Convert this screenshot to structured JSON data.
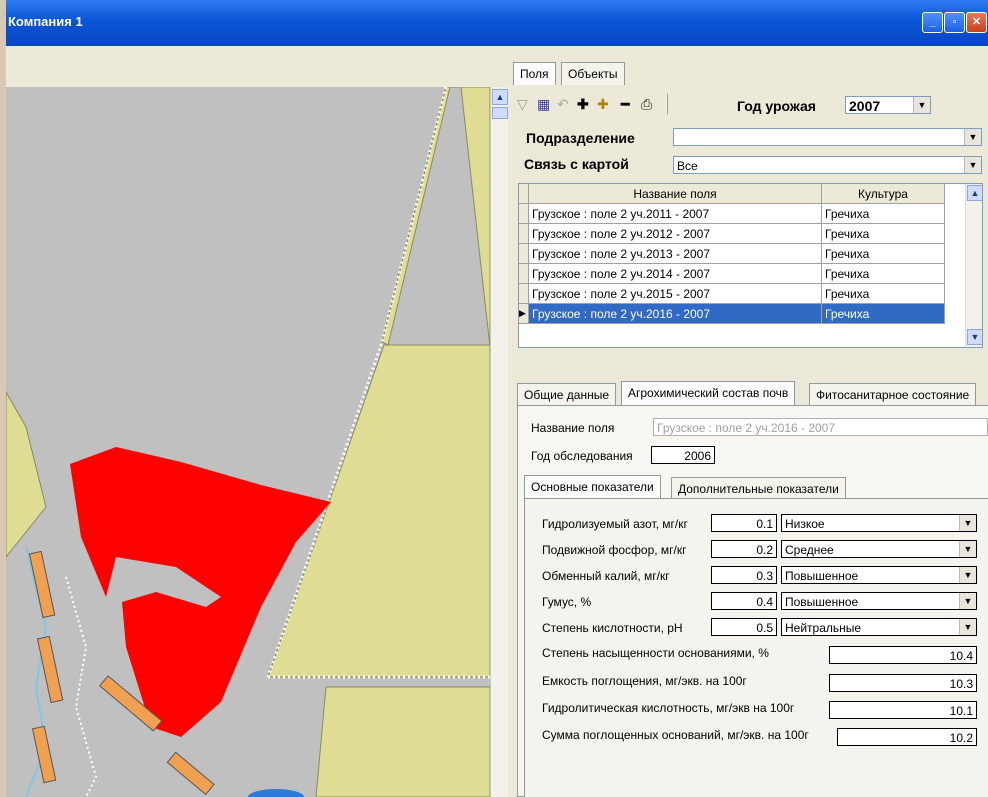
{
  "window": {
    "title": "Компания 1"
  },
  "panel": {
    "tabs": [
      "Поля",
      "Объекты"
    ],
    "year_label": "Год урожая",
    "year_value": "2007",
    "division_label": "Подразделение",
    "division_value": "",
    "map_link_label": "Связь с картой",
    "map_link_value": "Все",
    "grid": {
      "headers": [
        "Название поля",
        "Культура"
      ],
      "rows": [
        {
          "name": "Грузское : поле 2 уч.2011 - 2007",
          "crop": "Гречиха"
        },
        {
          "name": "Грузское : поле 2 уч.2012 - 2007",
          "crop": "Гречиха"
        },
        {
          "name": "Грузское : поле 2 уч.2013 - 2007",
          "crop": "Гречиха"
        },
        {
          "name": "Грузское : поле 2 уч.2014 - 2007",
          "crop": "Гречиха"
        },
        {
          "name": "Грузское : поле 2 уч.2015 - 2007",
          "crop": "Гречиха"
        },
        {
          "name": "Грузское : поле 2 уч.2016 - 2007",
          "crop": "Гречиха"
        }
      ]
    },
    "detail_tabs": [
      "Общие данные",
      "Агрохимический состав почв",
      "Фитосанитарное состояние"
    ],
    "field_name_label": "Название поля",
    "field_name_value": "Грузское : поле 2 уч.2016 - 2007",
    "survey_year_label": "Год обследования",
    "survey_year_value": "2006",
    "sub_tabs": [
      "Основные показатели",
      "Дополнительные показатели"
    ],
    "indicators": [
      {
        "label": "Гидролизуемый азот, мг/кг",
        "value": "0.1",
        "level": "Низкое"
      },
      {
        "label": "Подвижной фосфор, мг/кг",
        "value": "0.2",
        "level": "Среднее"
      },
      {
        "label": "Обменный калий, мг/кг",
        "value": "0.3",
        "level": "Повышенное"
      },
      {
        "label": "Гумус, %",
        "value": "0.4",
        "level": "Повышенное"
      },
      {
        "label": "Степень кислотности, pH",
        "value": "0.5",
        "level": "Нейтральные"
      }
    ],
    "extra": [
      {
        "label": "Степень насыщенности основаниями, %",
        "value": "10.4"
      },
      {
        "label": "Емкость поглощения, мг/экв. на 100г",
        "value": "10.3"
      },
      {
        "label": "Гидролитическая кислотность, мг/экв на 100г",
        "value": "10.1"
      },
      {
        "label": "Сумма поглощенных оснований, мг/экв. на 100г",
        "value": "10.2"
      }
    ]
  },
  "icons": [
    "filter-icon",
    "edit-icon",
    "undo-icon",
    "add-icon",
    "add-table-icon",
    "remove-icon",
    "print-icon"
  ]
}
